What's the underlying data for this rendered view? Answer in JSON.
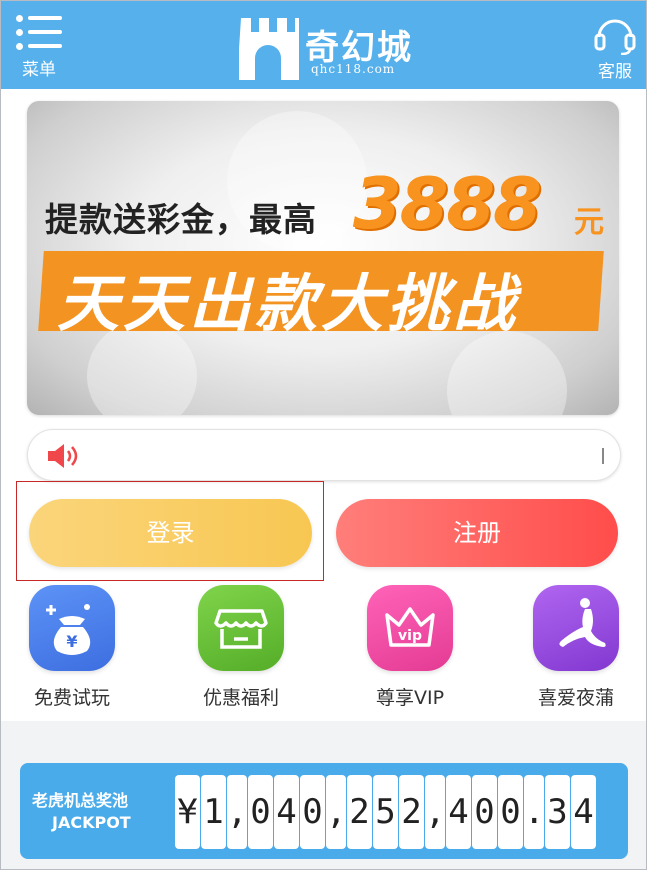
{
  "header": {
    "menu_label": "菜单",
    "logo_text": "奇幻城",
    "logo_sub": "qhc118.com",
    "service_label": "客服",
    "bg_color": "#55b0eb"
  },
  "banner": {
    "line1": "提款送彩金，最高",
    "amount": "3888",
    "unit": "元",
    "line2": "天天出款大挑战",
    "accent_color": "#f7931e"
  },
  "notice": {
    "icon": "speaker-icon",
    "text": ""
  },
  "buttons": {
    "login_label": "登录",
    "register_label": "注册"
  },
  "features": [
    {
      "label": "免费试玩",
      "icon": "money-bag-icon",
      "color": "#4f7cf0"
    },
    {
      "label": "优惠福利",
      "icon": "shop-icon",
      "color": "#6cc23a"
    },
    {
      "label": "尊享VIP",
      "icon": "vip-crown-icon",
      "color": "#f04fa8"
    },
    {
      "label": "喜爱夜蒲",
      "icon": "dancer-icon",
      "color": "#9b4fe0"
    }
  ],
  "jackpot": {
    "title": "老虎机总奖池",
    "subtitle": "JACKPOT",
    "value": "¥1,040,252,400.34",
    "chars": [
      "¥",
      "1",
      ",",
      "0",
      "4",
      "0",
      ",",
      "2",
      "5",
      "2",
      ",",
      "4",
      "0",
      "0",
      ".",
      "3",
      "4"
    ]
  }
}
